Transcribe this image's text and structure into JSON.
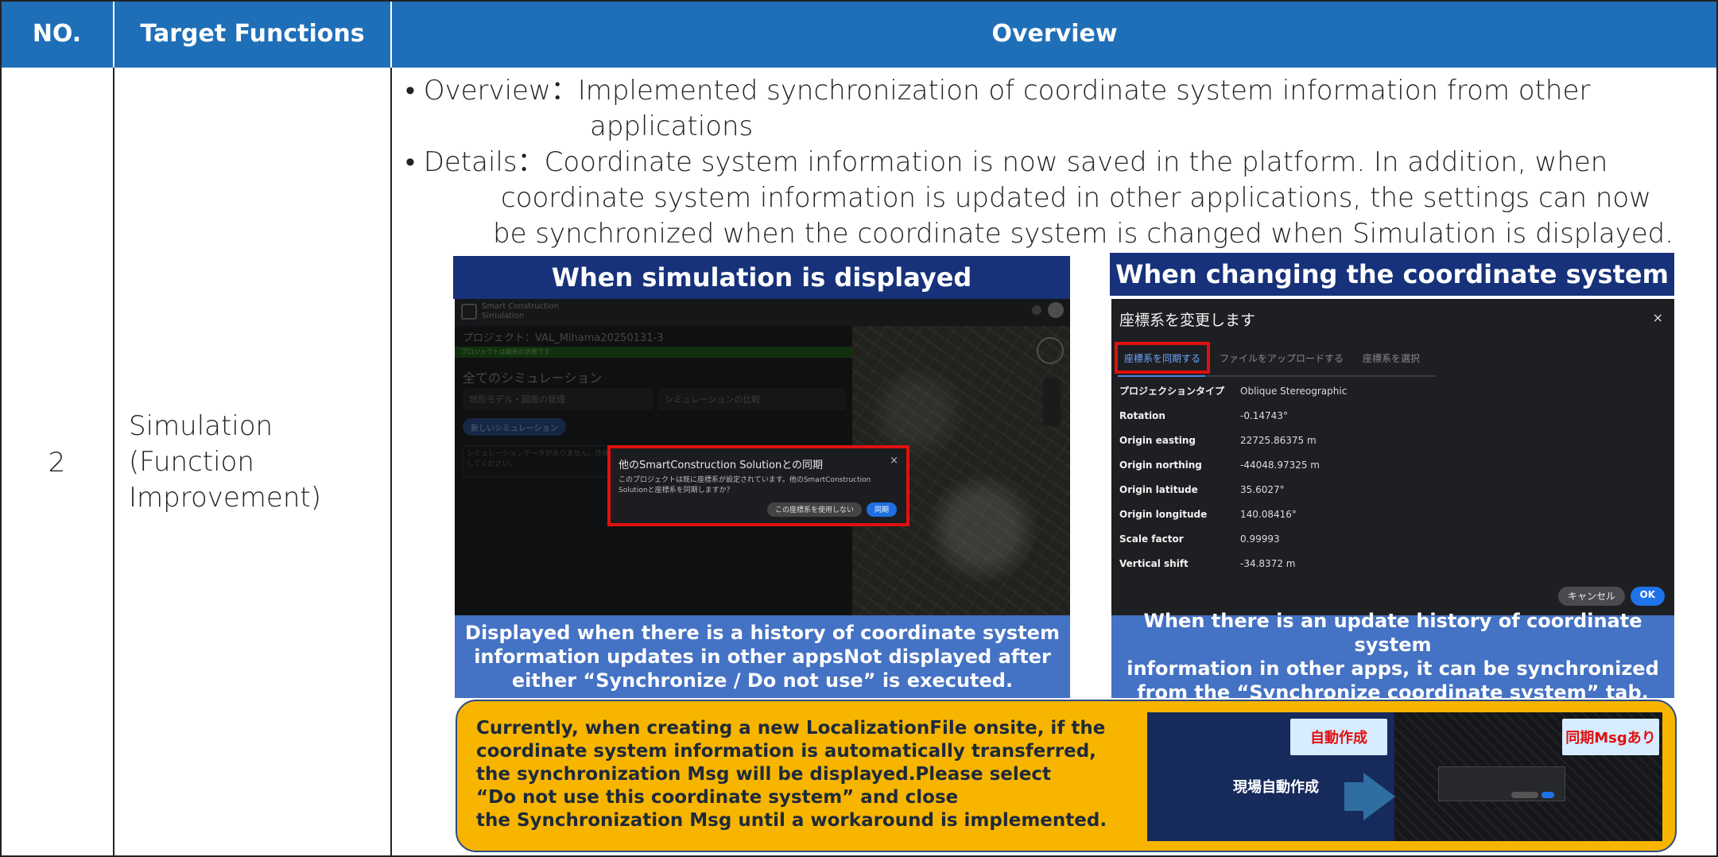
{
  "header": {
    "no": "NO.",
    "target_functions": "Target Functions",
    "overview": "Overview"
  },
  "row": {
    "no": "2",
    "target_function_lines": [
      "Simulation",
      "(Function",
      "Improvement)"
    ],
    "overview_lines": [
      "• Overview：Implemented synchronization of coordinate system information from other",
      "applications",
      "• Details：Coordinate system information is now saved in the platform. In addition, when",
      "coordinate system information is updated in other applications, the settings can now",
      "be synchronized when the coordinate system is changed when Simulation is displayed."
    ]
  },
  "left_panel": {
    "title": "When simulation is displayed",
    "caption_lines": [
      "Displayed when there is a history of coordinate system",
      "information updates in other appsNot displayed after",
      "either “Synchronize / Do not use” is executed."
    ],
    "screenshot": {
      "app_name_line1": "Smart Construction",
      "app_name_line2": "Simulation",
      "project": "プロジェクト：VAL_Mihama20250131-3",
      "green_bar": "プロジェクトは最新の状態です",
      "heading": "全てのシミュレーション",
      "select1": "地形モデル・図面の管理",
      "select2": "シミュレーションの比較",
      "new_button": "新しいシミュレーション",
      "info_box": "シミュレーションデータがありません。作成してください。",
      "dialog_title": "他のSmartConstruction Solutionとの同期",
      "dialog_close": "×",
      "dialog_body": "このプロジェクトは既に座標系が設定されています。他のSmartConstruction Solutionと座標系を同期しますか？",
      "dialog_btn_dont_use": "この座標系を使用しない",
      "dialog_btn_sync": "同期"
    }
  },
  "right_panel": {
    "title": "When changing the coordinate system",
    "caption_lines": [
      "When there is an update history of coordinate system",
      "information in other apps, it can be synchronized",
      "from the “Synchronize coordinate system” tab."
    ],
    "screenshot": {
      "title": "座標系を変更します",
      "close": "×",
      "tabs": [
        "座標系を同期する",
        "ファイルをアップロードする",
        "座標系を選択"
      ],
      "rows": [
        {
          "key": "プロジェクションタイプ",
          "value": "Oblique Stereographic"
        },
        {
          "key": "Rotation",
          "value": "-0.14743°"
        },
        {
          "key": "Origin easting",
          "value": "22725.86375 m"
        },
        {
          "key": "Origin northing",
          "value": "-44048.97325 m"
        },
        {
          "key": "Origin latitude",
          "value": "35.6027°"
        },
        {
          "key": "Origin longitude",
          "value": "140.08416°"
        },
        {
          "key": "Scale factor",
          "value": "0.99993"
        },
        {
          "key": "Vertical shift",
          "value": "-34.8372 m"
        }
      ],
      "cancel": "キャンセル",
      "ok": "OK"
    }
  },
  "note": {
    "lines": [
      "Currently, when creating a new LocalizationFile onsite, if the",
      "coordinate system information is automatically transferred,",
      "the synchronization Msg will be displayed.Please select",
      "“Do not use this coordinate system” and close",
      "the Synchronization Msg until a workaround is implemented."
    ],
    "tag_auto": "自動作成",
    "tag_sync": "同期Msgあり",
    "label_site": "現場自動作成"
  },
  "colors": {
    "header_blue": "#1f6fb8",
    "panel_title_navy": "#17327a",
    "caption_blue": "#4472c4",
    "note_yellow": "#f7b500",
    "highlight_red": "#e01010"
  }
}
